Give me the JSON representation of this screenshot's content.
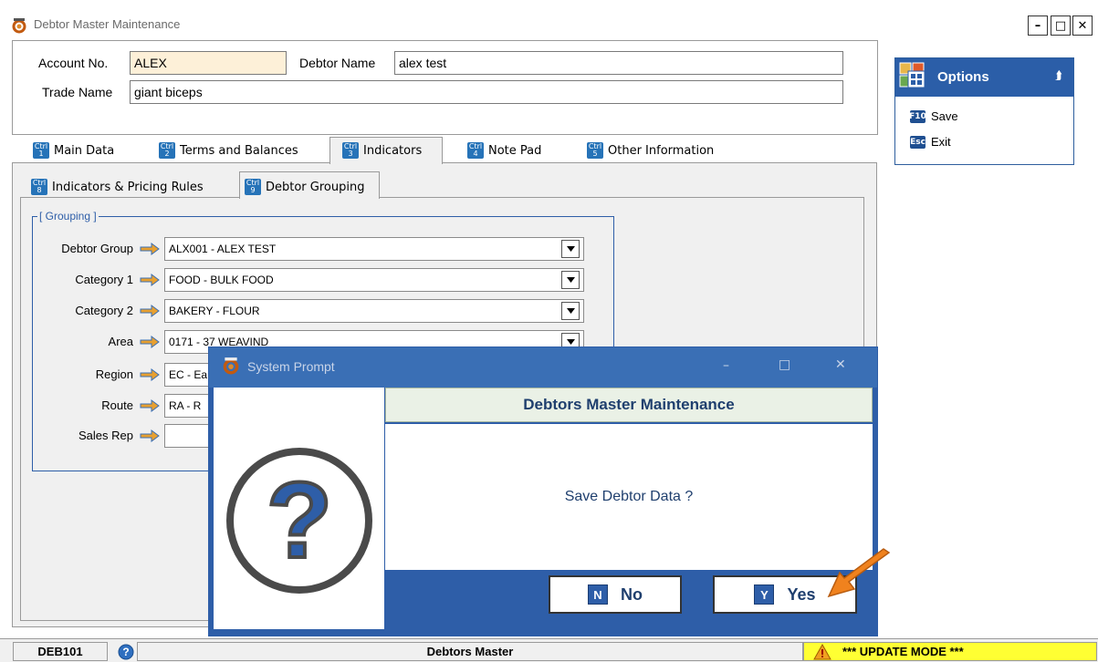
{
  "window": {
    "title": "Debtor Master Maintenance",
    "minimize_glyph": "–",
    "maximize_glyph": "□",
    "close_glyph": "✕"
  },
  "header": {
    "account_label": "Account No.",
    "account_value": "ALEX",
    "debtor_name_label": "Debtor Name",
    "debtor_name_value": "alex test",
    "trade_name_label": "Trade Name",
    "trade_name_value": "giant biceps"
  },
  "options": {
    "title": "Options",
    "items": [
      {
        "key": "F10",
        "label": "Save"
      },
      {
        "key": "Esc",
        "label": "Exit"
      }
    ]
  },
  "tabs": [
    {
      "ctrl": "1",
      "label": "Main Data"
    },
    {
      "ctrl": "2",
      "label": "Terms and Balances"
    },
    {
      "ctrl": "3",
      "label": "Indicators",
      "active": true
    },
    {
      "ctrl": "4",
      "label": "Note Pad"
    },
    {
      "ctrl": "5",
      "label": "Other Information"
    }
  ],
  "subtabs": [
    {
      "ctrl": "8",
      "label": "Indicators & Pricing Rules"
    },
    {
      "ctrl": "9",
      "label": "Debtor Grouping",
      "active": true
    }
  ],
  "ctrl_key_text": "Ctrl",
  "grouping": {
    "legend": "[ Grouping ]",
    "rows": [
      {
        "label": "Debtor Group",
        "value": "ALX001 - ALEX TEST"
      },
      {
        "label": "Category 1",
        "value": "FOOD - BULK FOOD"
      },
      {
        "label": "Category 2",
        "value": "BAKERY - FLOUR"
      },
      {
        "label": "Area",
        "value": "0171 - 37 WEAVIND"
      },
      {
        "label": "Region",
        "value": "EC - Ea"
      },
      {
        "label": "Route",
        "value": "RA - R"
      },
      {
        "label": "Sales Rep",
        "value": ""
      }
    ]
  },
  "dialog": {
    "title": "System Prompt",
    "header": "Debtors Master Maintenance",
    "message": "Save Debtor Data ?",
    "no_key": "N",
    "no_label": "No",
    "yes_key": "Y",
    "yes_label": "Yes",
    "question_glyph": "?"
  },
  "status": {
    "code": "DEB101",
    "center": "Debtors Master",
    "mode": "*** UPDATE MODE ***",
    "mode_color": "#ffff33"
  }
}
